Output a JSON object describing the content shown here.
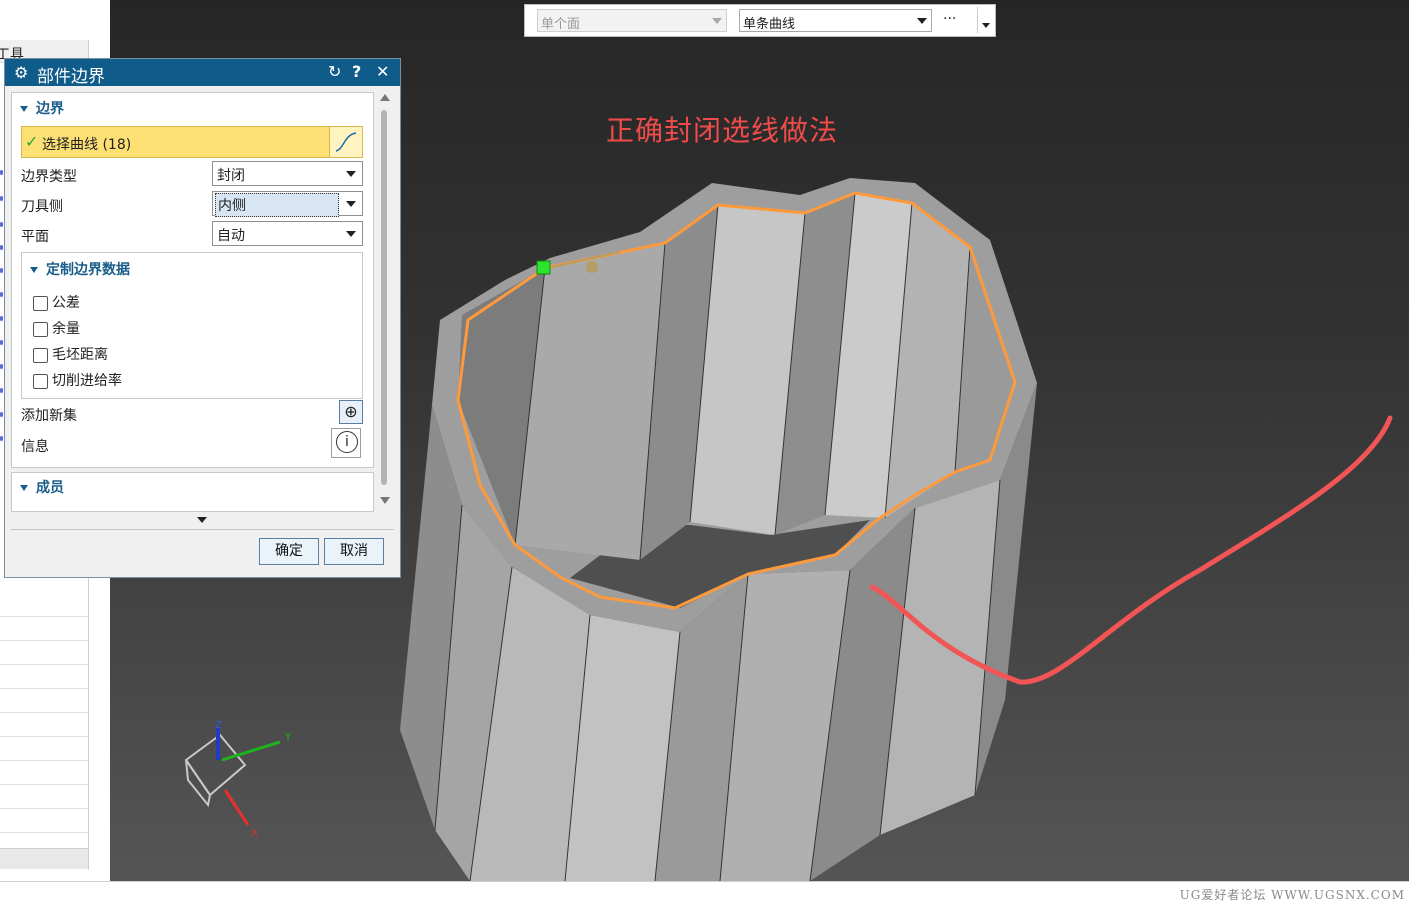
{
  "toolbar": {
    "filter_face": "单个面",
    "filter_curve": "单条曲线",
    "more_label": "···"
  },
  "left_panel": {
    "header_fragment": "工具"
  },
  "dialog": {
    "title": "部件边界",
    "boundary_section": "边界",
    "select_curve": "选择曲线 (18)",
    "boundary_type_label": "边界类型",
    "boundary_type_value": "封闭",
    "tool_side_label": "刀具侧",
    "tool_side_value": "内侧",
    "plane_label": "平面",
    "plane_value": "自动",
    "custom_section": "定制边界数据",
    "custom_options": [
      "公差",
      "余量",
      "毛坯距离",
      "切削进给率"
    ],
    "add_set_label": "添加新集",
    "info_label": "信息",
    "members_section": "成员",
    "ok_label": "确定",
    "cancel_label": "取消"
  },
  "annotation": {
    "text": "正确封闭选线做法",
    "color": "#ef4b4b"
  },
  "triad": {
    "x": "X",
    "y": "Y",
    "z": "Z"
  },
  "watermark": "UG爱好者论坛 WWW.UGSNX.COM",
  "colors": {
    "dialog_title_bg": "#0f5b89",
    "selection_highlight": "#fde074",
    "boundary_curve": "#ff9a3c",
    "annotation_red": "#ef4b4b"
  }
}
